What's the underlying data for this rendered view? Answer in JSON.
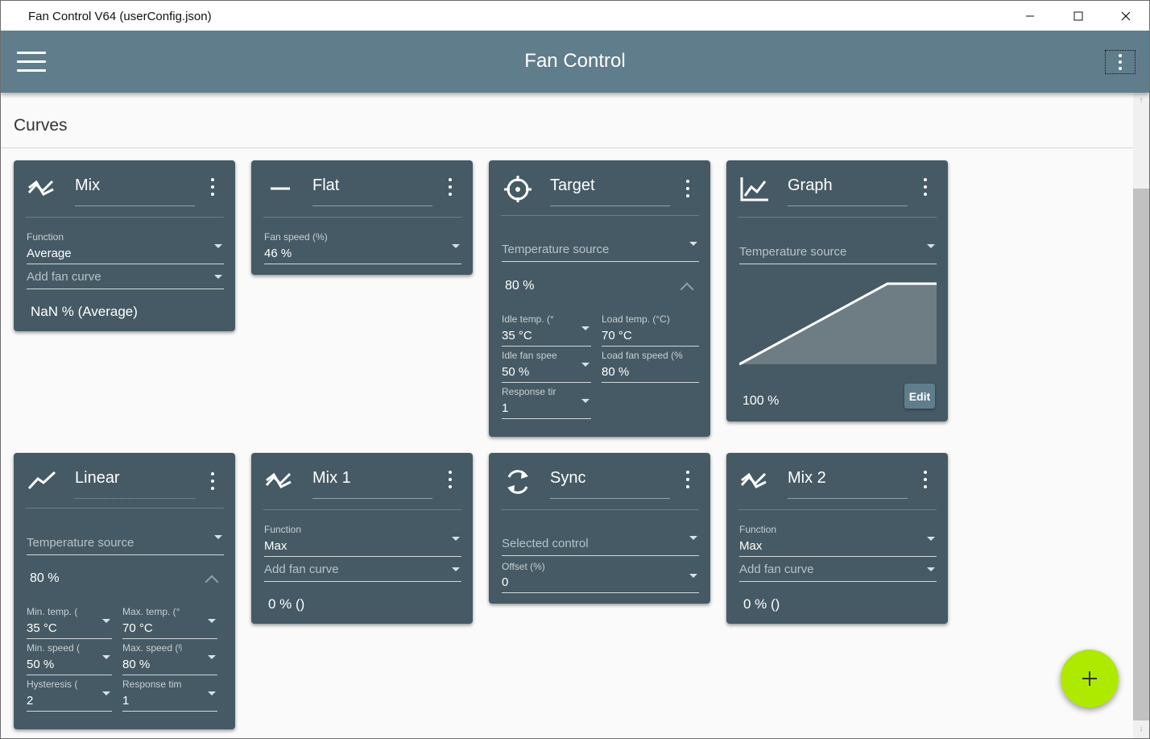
{
  "window": {
    "title": "Fan Control V64 (userConfig.json)",
    "minimize": "—",
    "maximize": "☐",
    "close": "✕"
  },
  "appbar": {
    "title": "Fan Control"
  },
  "section": {
    "title": "Curves"
  },
  "cards": {
    "mix": {
      "name": "Mix",
      "function_label": "Function",
      "function_value": "Average",
      "add_curve": "Add fan curve",
      "output": "NaN % (Average)"
    },
    "flat": {
      "name": "Flat",
      "speed_label": "Fan speed (%)",
      "speed_value": "46 %"
    },
    "target": {
      "name": "Target",
      "temp_source": "Temperature source",
      "value": "80 %",
      "idle_temp_label": "Idle temp. (°",
      "idle_temp_value": "35 °C",
      "load_temp_label": "Load temp. (°C)",
      "load_temp_value": "70 °C",
      "idle_speed_label": "Idle fan spee",
      "idle_speed_value": "50 %",
      "load_speed_label": "Load fan speed (%",
      "load_speed_value": "80 %",
      "response_label": "Response tir",
      "response_value": "1"
    },
    "graph": {
      "name": "Graph",
      "temp_source": "Temperature source",
      "value": "100 %",
      "edit": "Edit"
    },
    "linear": {
      "name": "Linear",
      "temp_source": "Temperature source",
      "value": "80 %",
      "min_temp_label": "Min. temp. (",
      "min_temp_value": "35 °C",
      "max_temp_label": "Max. temp. (°",
      "max_temp_value": "70 °C",
      "min_speed_label": "Min. speed (",
      "min_speed_value": "50 %",
      "max_speed_label": "Max. speed (%",
      "max_speed_value": "80 %",
      "hysteresis_label": "Hysteresis (",
      "hysteresis_value": "2",
      "response_label": "Response tim",
      "response_value": "1"
    },
    "mix1": {
      "name": "Mix 1",
      "function_label": "Function",
      "function_value": "Max",
      "add_curve": "Add fan curve",
      "output": "0 % ()"
    },
    "sync": {
      "name": "Sync",
      "selected_control": "Selected control",
      "offset_label": "Offset (%)",
      "offset_value": "0"
    },
    "mix2": {
      "name": "Mix 2",
      "function_label": "Function",
      "function_value": "Max",
      "add_curve": "Add fan curve",
      "output": "0 % ()"
    }
  },
  "fab": {
    "icon": "+"
  },
  "colors": {
    "appbar": "#607d8b",
    "card": "#455a64",
    "fab": "#aeea00"
  }
}
